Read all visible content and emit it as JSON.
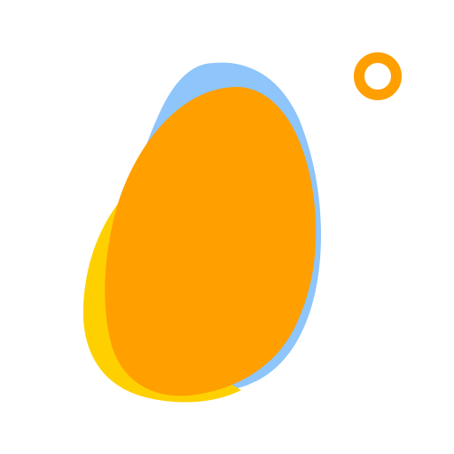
{
  "logo": {
    "icon": "blob-logo-icon",
    "colors": {
      "background": "#ffffff",
      "blue_blob": "#8EC5FA",
      "yellow_blob": "#FFD000",
      "orange_blob": "#FF9F00",
      "ring": "#FF9F00"
    }
  }
}
